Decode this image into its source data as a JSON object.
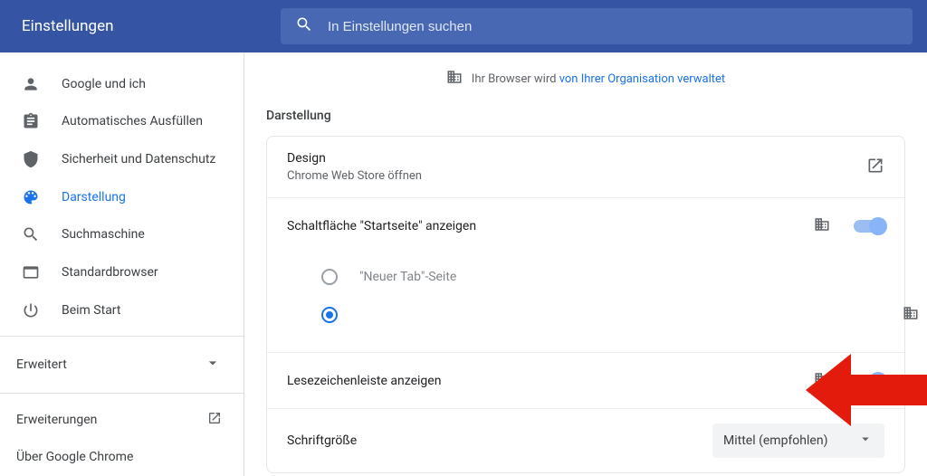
{
  "header": {
    "title": "Einstellungen",
    "search_placeholder": "In Einstellungen suchen"
  },
  "org_notice": {
    "prefix": "Ihr Browser wird ",
    "link": "von Ihrer Organisation verwaltet"
  },
  "sidebar": {
    "items": [
      {
        "label": "Google und ich"
      },
      {
        "label": "Automatisches Ausfüllen"
      },
      {
        "label": "Sicherheit und Datenschutz"
      },
      {
        "label": "Darstellung"
      },
      {
        "label": "Suchmaschine"
      },
      {
        "label": "Standardbrowser"
      },
      {
        "label": "Beim Start"
      }
    ],
    "advanced": "Erweitert",
    "extensions": "Erweiterungen",
    "about": "Über Google Chrome"
  },
  "appearance": {
    "section_title": "Darstellung",
    "design": {
      "title": "Design",
      "subtitle": "Chrome Web Store öffnen"
    },
    "home_button": {
      "title": "Schaltfläche \"Startseite\" anzeigen",
      "radio_new_tab": "\"Neuer Tab\"-Seite"
    },
    "bookmarks_bar": "Lesezeichenleiste anzeigen",
    "font_size": {
      "label": "Schriftgröße",
      "value": "Mittel (empfohlen)"
    }
  }
}
